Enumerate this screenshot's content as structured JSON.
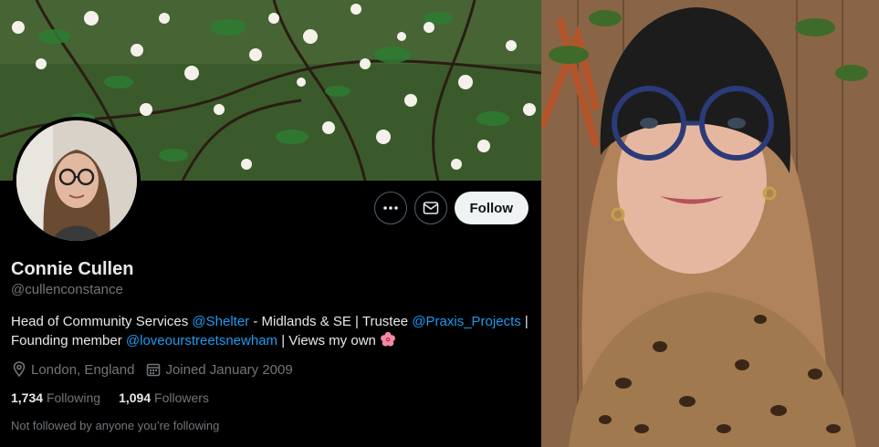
{
  "profile": {
    "name": "Connie Cullen",
    "handle": "@cullenconstance",
    "bio": {
      "t1": "Head of Community Services ",
      "m1": "@Shelter",
      "t2": " - Midlands & SE | Trustee ",
      "m2": "@Praxis_Projects",
      "t3": " | Founding member ",
      "m3": "@loveourstreetsnewham",
      "t4": " | Views my own "
    },
    "location": "London, England",
    "joined": "Joined January 2009",
    "following_count": "1,734",
    "following_label": "Following",
    "followers_count": "1,094",
    "followers_label": "Followers",
    "followed_by_note": "Not followed by anyone you’re following"
  },
  "actions": {
    "follow_label": "Follow",
    "more_icon": "more-dots-icon",
    "message_icon": "envelope-icon"
  },
  "colors": {
    "accent": "#1d9bf0",
    "background": "#000000",
    "muted": "#71767b",
    "follow_button": "#eff3f4"
  }
}
